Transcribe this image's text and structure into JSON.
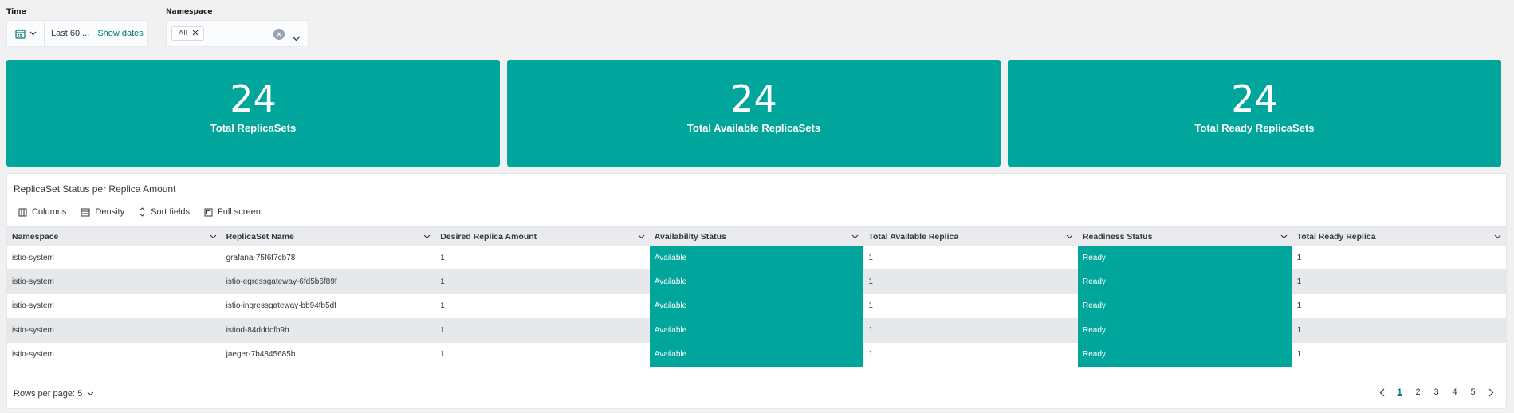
{
  "filters": {
    "time": {
      "label": "Time",
      "value": "Last 60 ...",
      "show_dates": "Show dates",
      "icon": "calendar-icon"
    },
    "namespace": {
      "label": "Namespace",
      "selected_pill": "All"
    }
  },
  "metrics": [
    {
      "value": "24",
      "label": "Total ReplicaSets"
    },
    {
      "value": "24",
      "label": "Total Available ReplicaSets"
    },
    {
      "value": "24",
      "label": "Total Ready ReplicaSets"
    }
  ],
  "accent_color": "#00a69b",
  "table": {
    "title": "ReplicaSet Status per Replica Amount",
    "toolbar": {
      "columns": "Columns",
      "density": "Density",
      "sort_fields": "Sort fields",
      "full_screen": "Full screen"
    },
    "headers": [
      "Namespace",
      "ReplicaSet Name",
      "Desired Replica Amount",
      "Availability Status",
      "Total Available Replica",
      "Readiness Status",
      "Total Ready Replica"
    ],
    "rows": [
      [
        "istio-system",
        "grafana-75f6f7cb78",
        "1",
        "Available",
        "1",
        "Ready",
        "1"
      ],
      [
        "istio-system",
        "istio-egressgateway-6fd5b6f89f",
        "1",
        "Available",
        "1",
        "Ready",
        "1"
      ],
      [
        "istio-system",
        "istio-ingressgateway-bb94fb5df",
        "1",
        "Available",
        "1",
        "Ready",
        "1"
      ],
      [
        "istio-system",
        "istiod-84dddcfb9b",
        "1",
        "Available",
        "1",
        "Ready",
        "1"
      ],
      [
        "istio-system",
        "jaeger-7b4845685b",
        "1",
        "Available",
        "1",
        "Ready",
        "1"
      ]
    ],
    "rows_per_page": "Rows per page: 5",
    "pages": [
      "1",
      "2",
      "3",
      "4",
      "5"
    ],
    "current_page": "1"
  }
}
